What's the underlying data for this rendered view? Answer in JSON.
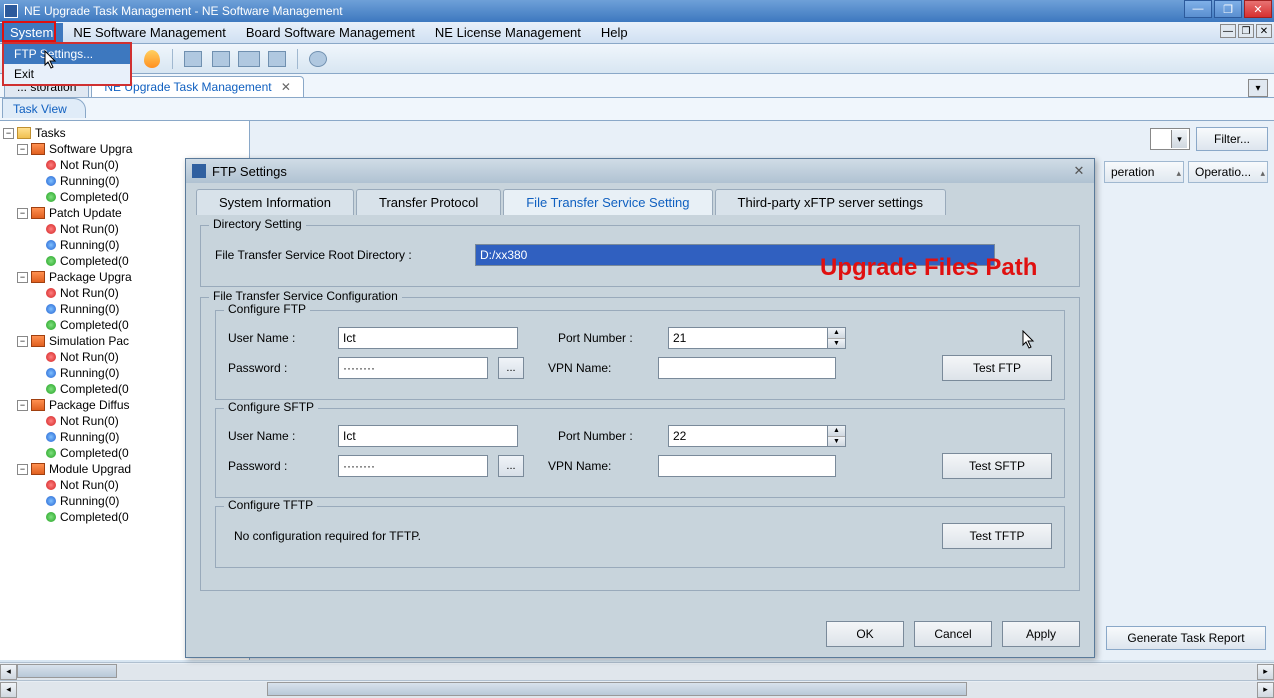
{
  "window": {
    "title": "NE Upgrade Task Management - NE Software Management"
  },
  "menu": {
    "items": [
      "System",
      "NE Software Management",
      "Board Software Management",
      "NE License Management",
      "Help"
    ],
    "active_index": 0,
    "dropdown": {
      "items": [
        "FTP Settings...",
        "Exit"
      ],
      "hl_index": 0
    }
  },
  "doc_tabs": {
    "inactive": "... storation",
    "active": "NE Upgrade Task Management"
  },
  "taskview_label": "Task View",
  "tree": {
    "root": "Tasks",
    "groups": [
      {
        "name": "Software Upgra",
        "children": [
          {
            "dot": "red",
            "label": "Not Run(0)"
          },
          {
            "dot": "blue",
            "label": "Running(0)"
          },
          {
            "dot": "green",
            "label": "Completed(0"
          }
        ]
      },
      {
        "name": "Patch Update",
        "children": [
          {
            "dot": "red",
            "label": "Not Run(0)"
          },
          {
            "dot": "blue",
            "label": "Running(0)"
          },
          {
            "dot": "green",
            "label": "Completed(0"
          }
        ]
      },
      {
        "name": "Package Upgra",
        "children": [
          {
            "dot": "red",
            "label": "Not Run(0)"
          },
          {
            "dot": "blue",
            "label": "Running(0)"
          },
          {
            "dot": "green",
            "label": "Completed(0"
          }
        ]
      },
      {
        "name": "Simulation Pac",
        "children": [
          {
            "dot": "red",
            "label": "Not Run(0)"
          },
          {
            "dot": "blue",
            "label": "Running(0)"
          },
          {
            "dot": "green",
            "label": "Completed(0"
          }
        ]
      },
      {
        "name": "Package Diffus",
        "children": [
          {
            "dot": "red",
            "label": "Not Run(0)"
          },
          {
            "dot": "blue",
            "label": "Running(0)"
          },
          {
            "dot": "green",
            "label": "Completed(0"
          }
        ]
      },
      {
        "name": "Module Upgrad",
        "children": [
          {
            "dot": "red",
            "label": "Not Run(0)"
          },
          {
            "dot": "blue",
            "label": "Running(0)"
          },
          {
            "dot": "green",
            "label": "Completed(0"
          }
        ]
      }
    ]
  },
  "content": {
    "filter_btn": "Filter...",
    "columns": [
      "peration",
      "Operatio..."
    ],
    "gen_report": "Generate Task Report"
  },
  "dialog": {
    "title": "FTP Settings",
    "tabs": [
      "System Information",
      "Transfer Protocol",
      "File Transfer Service Setting",
      "Third-party xFTP server settings"
    ],
    "active_tab": 2,
    "dir_group": "Directory Setting",
    "dir_label": "File Transfer Service Root Directory :",
    "dir_value": "D:/xx380",
    "cfg_group": "File Transfer Service Configuration",
    "ftp": {
      "title": "Configure FTP",
      "user_label": "User Name :",
      "user_value": "Ict",
      "port_label": "Port Number :",
      "port_value": "21",
      "pass_label": "Password :",
      "pass_value": "········",
      "vpn_label": "VPN Name:",
      "vpn_value": "",
      "test_btn": "Test FTP"
    },
    "sftp": {
      "title": "Configure SFTP",
      "user_label": "User Name :",
      "user_value": "Ict",
      "port_label": "Port Number :",
      "port_value": "22",
      "pass_label": "Password :",
      "pass_value": "········",
      "vpn_label": "VPN Name:",
      "vpn_value": "",
      "test_btn": "Test SFTP"
    },
    "tftp": {
      "title": "Configure TFTP",
      "msg": "No configuration required for TFTP.",
      "test_btn": "Test TFTP"
    },
    "buttons": {
      "ok": "OK",
      "cancel": "Cancel",
      "apply": "Apply"
    }
  },
  "annotation": "Upgrade Files Path"
}
